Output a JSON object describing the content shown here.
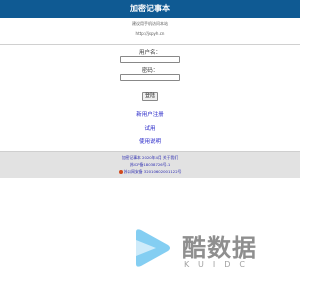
{
  "app": {
    "title": "加密记事本"
  },
  "intro": {
    "tagline": "建议用手机访问本站",
    "url": "http://jspyh.cn"
  },
  "login": {
    "username_label": "用户名：",
    "username_value": "",
    "password_label": "密码：",
    "password_value": "",
    "submit_label": "登陆"
  },
  "links": {
    "register": "新用户注册",
    "try": "试用",
    "help": "使用说明"
  },
  "footer": {
    "line1": "加密记事本  2020年4月  关于我们",
    "line2": "苏ICP备18038726号-1",
    "line3": "苏公网安备 32010602001122号"
  },
  "watermark": {
    "brand_text": "酷数据",
    "brand_sub": "KUIDC"
  },
  "colors": {
    "header_bg": "#0f5a93",
    "link": "#2323c8",
    "footer_bg": "#e2e2e2"
  }
}
